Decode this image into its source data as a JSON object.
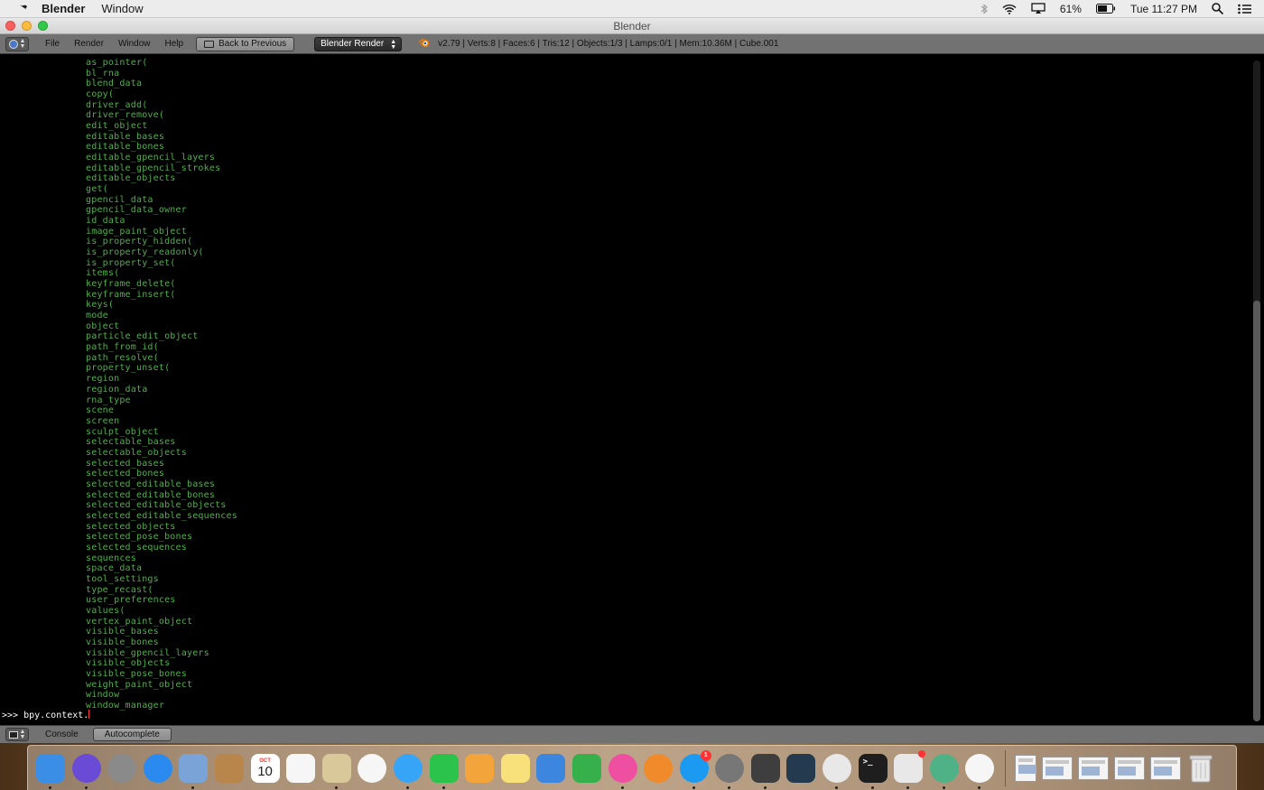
{
  "menubar": {
    "app_name": "Blender",
    "menu_window": "Window",
    "battery": "61%",
    "clock": "Tue 11:27 PM"
  },
  "window": {
    "title": "Blender"
  },
  "header": {
    "menus": [
      "File",
      "Render",
      "Window",
      "Help"
    ],
    "back_button": "Back to Previous",
    "render_engine": "Blender Render",
    "stats": "v2.79 | Verts:8 | Faces:6 | Tris:12 | Objects:1/3 | Lamps:0/1 | Mem:10.36M | Cube.001"
  },
  "console": {
    "lines": [
      "as_pointer(",
      "bl_rna",
      "blend_data",
      "copy(",
      "driver_add(",
      "driver_remove(",
      "edit_object",
      "editable_bases",
      "editable_bones",
      "editable_gpencil_layers",
      "editable_gpencil_strokes",
      "editable_objects",
      "get(",
      "gpencil_data",
      "gpencil_data_owner",
      "id_data",
      "image_paint_object",
      "is_property_hidden(",
      "is_property_readonly(",
      "is_property_set(",
      "items(",
      "keyframe_delete(",
      "keyframe_insert(",
      "keys(",
      "mode",
      "object",
      "particle_edit_object",
      "path_from_id(",
      "path_resolve(",
      "property_unset(",
      "region",
      "region_data",
      "rna_type",
      "scene",
      "screen",
      "sculpt_object",
      "selectable_bases",
      "selectable_objects",
      "selected_bases",
      "selected_bones",
      "selected_editable_bases",
      "selected_editable_bones",
      "selected_editable_objects",
      "selected_editable_sequences",
      "selected_objects",
      "selected_pose_bones",
      "selected_sequences",
      "sequences",
      "space_data",
      "tool_settings",
      "type_recast(",
      "user_preferences",
      "values(",
      "vertex_paint_object",
      "visible_bases",
      "visible_bones",
      "visible_gpencil_layers",
      "visible_objects",
      "visible_pose_bones",
      "weight_paint_object",
      "window",
      "window_manager"
    ],
    "prompt": ">>> bpy.context."
  },
  "footer": {
    "console_menu": "Console",
    "autocomplete_button": "Autocomplete"
  },
  "dock": {
    "calendar_month": "OCT",
    "calendar_day": "10",
    "items": [
      {
        "name": "finder-icon",
        "color": "#3a8ee6"
      },
      {
        "name": "siri-icon",
        "color": "#6a4bd6"
      },
      {
        "name": "launchpad-icon",
        "color": "#8a8a8a"
      },
      {
        "name": "safari-icon",
        "color": "#2a8af0"
      },
      {
        "name": "mail-stamp-icon",
        "color": "#7aa4d8"
      },
      {
        "name": "contacts-icon",
        "color": "#b8864a"
      },
      {
        "name": "calendar-icon",
        "color": "#ffffff"
      },
      {
        "name": "reminders-icon",
        "color": "#f6f6f6"
      },
      {
        "name": "preview-icon",
        "color": "#d9c89a"
      },
      {
        "name": "photos-icon",
        "color": "#f6f6f6"
      },
      {
        "name": "messages-icon",
        "color": "#37a5f7"
      },
      {
        "name": "facetime-icon",
        "color": "#2bc34b"
      },
      {
        "name": "pages-icon",
        "color": "#f3a43a"
      },
      {
        "name": "notes-icon",
        "color": "#f8e07a"
      },
      {
        "name": "keynote-icon",
        "color": "#3c86e0"
      },
      {
        "name": "numbers-icon",
        "color": "#36b04a"
      },
      {
        "name": "itunes-icon",
        "color": "#ee4fa0"
      },
      {
        "name": "ibooks-icon",
        "color": "#f08a2a"
      },
      {
        "name": "app-store-icon",
        "color": "#1a9af0"
      },
      {
        "name": "system-preferences-icon",
        "color": "#777777"
      },
      {
        "name": "sublime-text-icon",
        "color": "#3e3e3e"
      },
      {
        "name": "brackets-icon",
        "color": "#243a4e"
      },
      {
        "name": "chrome-icon",
        "color": "#e8e8e8"
      },
      {
        "name": "terminal-icon",
        "color": "#1e1e1e"
      },
      {
        "name": "slack-icon",
        "color": "#e8e8e8"
      },
      {
        "name": "atom-icon",
        "color": "#4fb286"
      },
      {
        "name": "blender-icon",
        "color": "#f6f6f6"
      }
    ],
    "itunes_badge": "",
    "app_store_badge": "1"
  }
}
